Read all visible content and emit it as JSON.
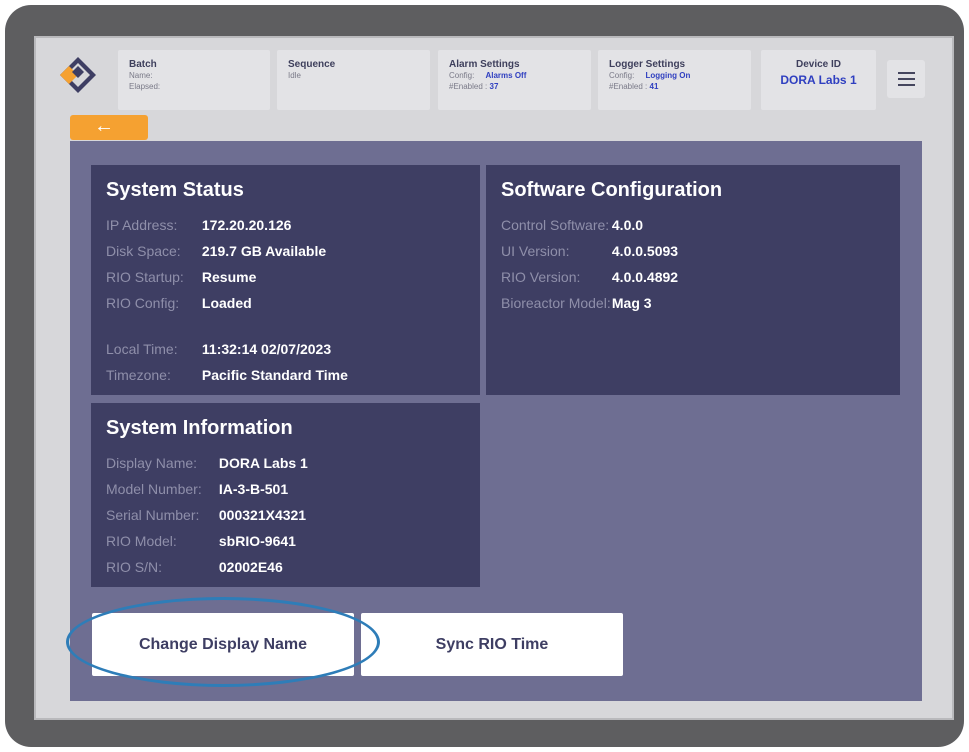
{
  "header": {
    "batch": {
      "title": "Batch",
      "name_label": "Name:",
      "elapsed_label": "Elapsed:"
    },
    "sequence": {
      "title": "Sequence",
      "status": "Idle"
    },
    "alarm": {
      "title": "Alarm Settings",
      "config_label": "Config:",
      "config_value": "Alarms Off",
      "enabled_label": "#Enabled :",
      "enabled_value": "37"
    },
    "logger": {
      "title": "Logger Settings",
      "config_label": "Config:",
      "config_value": "Logging On",
      "enabled_label": "#Enabled :",
      "enabled_value": "41"
    },
    "device": {
      "title": "Device ID",
      "value": "DORA Labs 1"
    },
    "menu_icon": "hamburger-menu-icon",
    "back_icon": "←"
  },
  "system_status": {
    "title": "System Status",
    "rows": [
      {
        "label": "IP Address:",
        "value": "172.20.20.126"
      },
      {
        "label": "Disk Space:",
        "value": "219.7 GB Available"
      },
      {
        "label": "RIO Startup:",
        "value": "Resume"
      },
      {
        "label": "RIO Config:",
        "value": "Loaded"
      },
      {
        "label": "Local Time:",
        "value": "11:32:14 02/07/2023"
      },
      {
        "label": "Timezone:",
        "value": "Pacific Standard Time"
      }
    ]
  },
  "software_configuration": {
    "title": "Software Configuration",
    "rows": [
      {
        "label": "Control Software:",
        "value": "4.0.0"
      },
      {
        "label": "UI Version:",
        "value": "4.0.0.5093"
      },
      {
        "label": "RIO Version:",
        "value": "4.0.0.4892"
      },
      {
        "label": "Bioreactor Model:",
        "value": "Mag 3"
      }
    ]
  },
  "system_information": {
    "title": "System Information",
    "rows": [
      {
        "label": "Display Name:",
        "value": "DORA Labs 1"
      },
      {
        "label": "Model Number:",
        "value": "IA-3-B-501"
      },
      {
        "label": "Serial Number:",
        "value": "000321X4321"
      },
      {
        "label": "RIO Model:",
        "value": "sbRIO-9641"
      },
      {
        "label": "RIO S/N:",
        "value": "02002E46"
      }
    ]
  },
  "buttons": {
    "change_display_name": "Change Display Name",
    "sync_rio_time": "Sync RIO Time"
  },
  "colors": {
    "accent_orange": "#f5a131",
    "panel_bg": "#3e3e63",
    "main_bg": "#6e6e92",
    "highlight_blue": "#2f3fc0",
    "annotation_ring": "#2e7db8"
  }
}
